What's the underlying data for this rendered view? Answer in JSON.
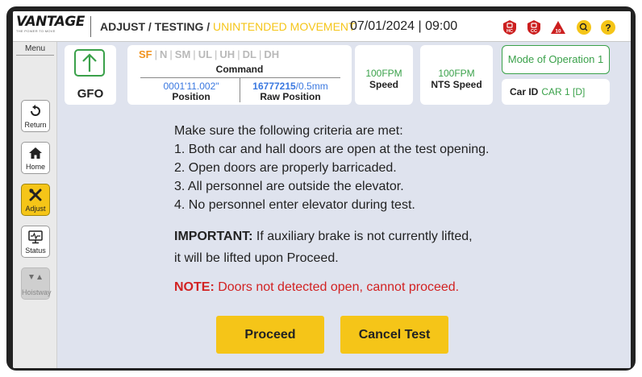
{
  "header": {
    "logo_text": "VANTAGE",
    "logo_tagline": "THE POWER TO MOVE",
    "breadcrumb_prefix": "ADJUST / TESTING / ",
    "breadcrumb_active": "UNINTENDED MOVEMENT",
    "datetime": "07/01/2024 | 09:00",
    "icons": [
      {
        "name": "hc-lock-icon",
        "text": "HC"
      },
      {
        "name": "cc-lock-icon",
        "text": "CC"
      },
      {
        "name": "alarm-count-icon",
        "text": "10"
      },
      {
        "name": "search-icon",
        "text": ""
      },
      {
        "name": "help-icon",
        "text": "?"
      }
    ]
  },
  "sidebar": {
    "title": "Menu",
    "items": [
      {
        "label": "Return",
        "icon": "return-icon",
        "state": "normal"
      },
      {
        "label": "Home",
        "icon": "home-icon",
        "state": "normal"
      },
      {
        "label": "Adjust",
        "icon": "tools-icon",
        "state": "active"
      },
      {
        "label": "Status",
        "icon": "monitor-icon",
        "state": "normal"
      },
      {
        "label": "Hoistway",
        "icon": "hoistway-icon",
        "state": "disabled"
      }
    ]
  },
  "status": {
    "gfo_label": "GFO",
    "command_flags": [
      {
        "label": "SF",
        "active": true
      },
      {
        "label": "N",
        "active": false
      },
      {
        "label": "SM",
        "active": false
      },
      {
        "label": "UL",
        "active": false
      },
      {
        "label": "UH",
        "active": false
      },
      {
        "label": "DL",
        "active": false
      },
      {
        "label": "DH",
        "active": false
      }
    ],
    "command_label": "Command",
    "position_value": "0001'11.002\"",
    "position_label": "Position",
    "raw_position_count": "16777215",
    "raw_position_unit": "/0.5mm",
    "raw_position_label": "Raw Position",
    "speed_value": "100FPM",
    "speed_label": "Speed",
    "nts_speed_value": "100FPM",
    "nts_speed_label": "NTS Speed",
    "mode_of_operation": "Mode of Operation 1",
    "car_id_label": "Car ID",
    "car_id_value": "CAR 1 [D]"
  },
  "message": {
    "intro": "Make sure the following criteria are met:",
    "criteria": [
      "1. Both car and hall doors are open at the test opening.",
      "2. Open doors are properly barricaded.",
      "3. All personnel are outside the elevator.",
      "4. No personnel enter elevator during test."
    ],
    "important_label": "IMPORTANT:",
    "important_text": " If auxiliary brake is not currently lifted,",
    "important_text_2": "it will be lifted upon Proceed.",
    "note_label": "NOTE:",
    "note_text": " Doors not detected open, cannot proceed."
  },
  "actions": {
    "proceed_label": "Proceed",
    "cancel_label": "Cancel Test"
  },
  "colors": {
    "accent_yellow": "#f5c518",
    "green": "#3aa14a",
    "blue": "#3a78e0",
    "orange": "#f0931f",
    "red": "#d22222"
  }
}
